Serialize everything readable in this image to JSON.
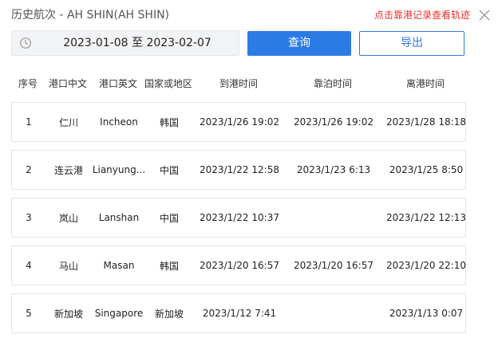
{
  "header": {
    "title": "历史航次 - AH SHIN(AH SHIN)",
    "track_link": "点击靠港记录查看轨迹"
  },
  "toolbar": {
    "date_range": "2023-01-08 至 2023-02-07",
    "query_label": "查询",
    "export_label": "导出"
  },
  "table": {
    "columns": [
      "序号",
      "港口中文",
      "港口英文",
      "国家或地区",
      "到港时间",
      "靠泊时间",
      "离港时间"
    ],
    "rows": [
      [
        "1",
        "仁川",
        "Incheon",
        "韩国",
        "2023/1/26 19:02",
        "2023/1/26 19:02",
        "2023/1/28 18:18"
      ],
      [
        "2",
        "连云港",
        "Lianyung...",
        "中国",
        "2023/1/22 12:58",
        "2023/1/23 6:13",
        "2023/1/25 8:50"
      ],
      [
        "3",
        "岚山",
        "Lanshan",
        "中国",
        "2023/1/22 10:37",
        "",
        "2023/1/22 12:13"
      ],
      [
        "4",
        "马山",
        "Masan",
        "韩国",
        "2023/1/20 16:57",
        "2023/1/20 16:57",
        "2023/1/20 22:10"
      ],
      [
        "5",
        "新加坡",
        "Singapore",
        "新加坡",
        "2023/1/12 7:41",
        "",
        "2023/1/13 0:07"
      ]
    ]
  },
  "icons": {
    "clock": "clock-icon",
    "close": "close-icon"
  },
  "colors": {
    "accent": "#2c7be5",
    "link_red": "#e8302f",
    "row_border": "#e2e4e8",
    "date_bg": "#f2f3f5"
  }
}
